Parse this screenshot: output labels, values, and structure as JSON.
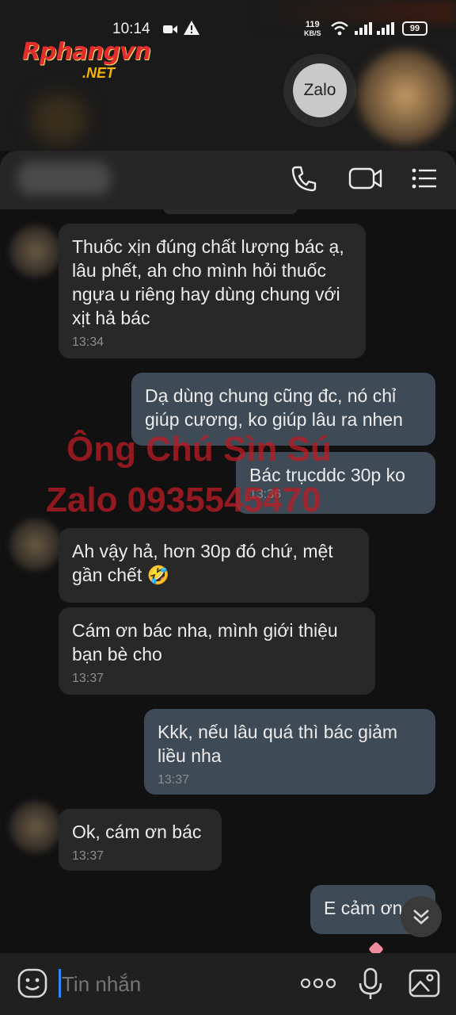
{
  "status_bar": {
    "time": "10:14",
    "net_speed_value": "119",
    "net_speed_unit": "KB/S",
    "battery": "99"
  },
  "logo": {
    "main": "Rphangvn",
    "net": ".NET"
  },
  "zalo_badge": "Zalo",
  "header": {
    "icons": [
      "phone-icon",
      "video-camera-icon",
      "menu-list-icon"
    ]
  },
  "messages": [
    {
      "side": "in",
      "text": "Thuốc xịn đúng chất lượng bác ạ, lâu phết, ah cho mình hỏi thuốc ngựa u riêng hay dùng chung với xịt hả bác",
      "time": "13:34"
    },
    {
      "side": "out",
      "text": "Dạ dùng chung cũng đc, nó chỉ giúp cương, ko giúp lâu ra nhen",
      "time": ""
    },
    {
      "side": "out",
      "text": "Bác trụcddc 30p ko",
      "time": "13:36"
    },
    {
      "side": "in",
      "text": "Ah vậy hả, hơn 30p đó chứ, mệt gần chết 🤣",
      "time": ""
    },
    {
      "side": "in",
      "text": "Cám ơn bác nha, mình giới thiệu bạn bè cho",
      "time": "13:37"
    },
    {
      "side": "out",
      "text": "Kkk, nếu lâu quá thì bác giảm liều nha",
      "time": "13:37"
    },
    {
      "side": "in",
      "text": "Ok, cám ơn bác",
      "time": "13:37"
    },
    {
      "side": "out",
      "text": "E cảm ơn",
      "time": ""
    }
  ],
  "watermark": {
    "line1": "Ông Chú Sìn Sú",
    "line2": "Zalo 0935545470"
  },
  "composer": {
    "placeholder": "Tin nhắn",
    "icons": [
      "sticker-icon",
      "more-icon",
      "microphone-icon",
      "image-icon"
    ]
  },
  "colors": {
    "incoming_bubble": "#282828",
    "outgoing_bubble": "#3e4a56",
    "watermark": "#be1c26",
    "cursor": "#2a8cff"
  }
}
